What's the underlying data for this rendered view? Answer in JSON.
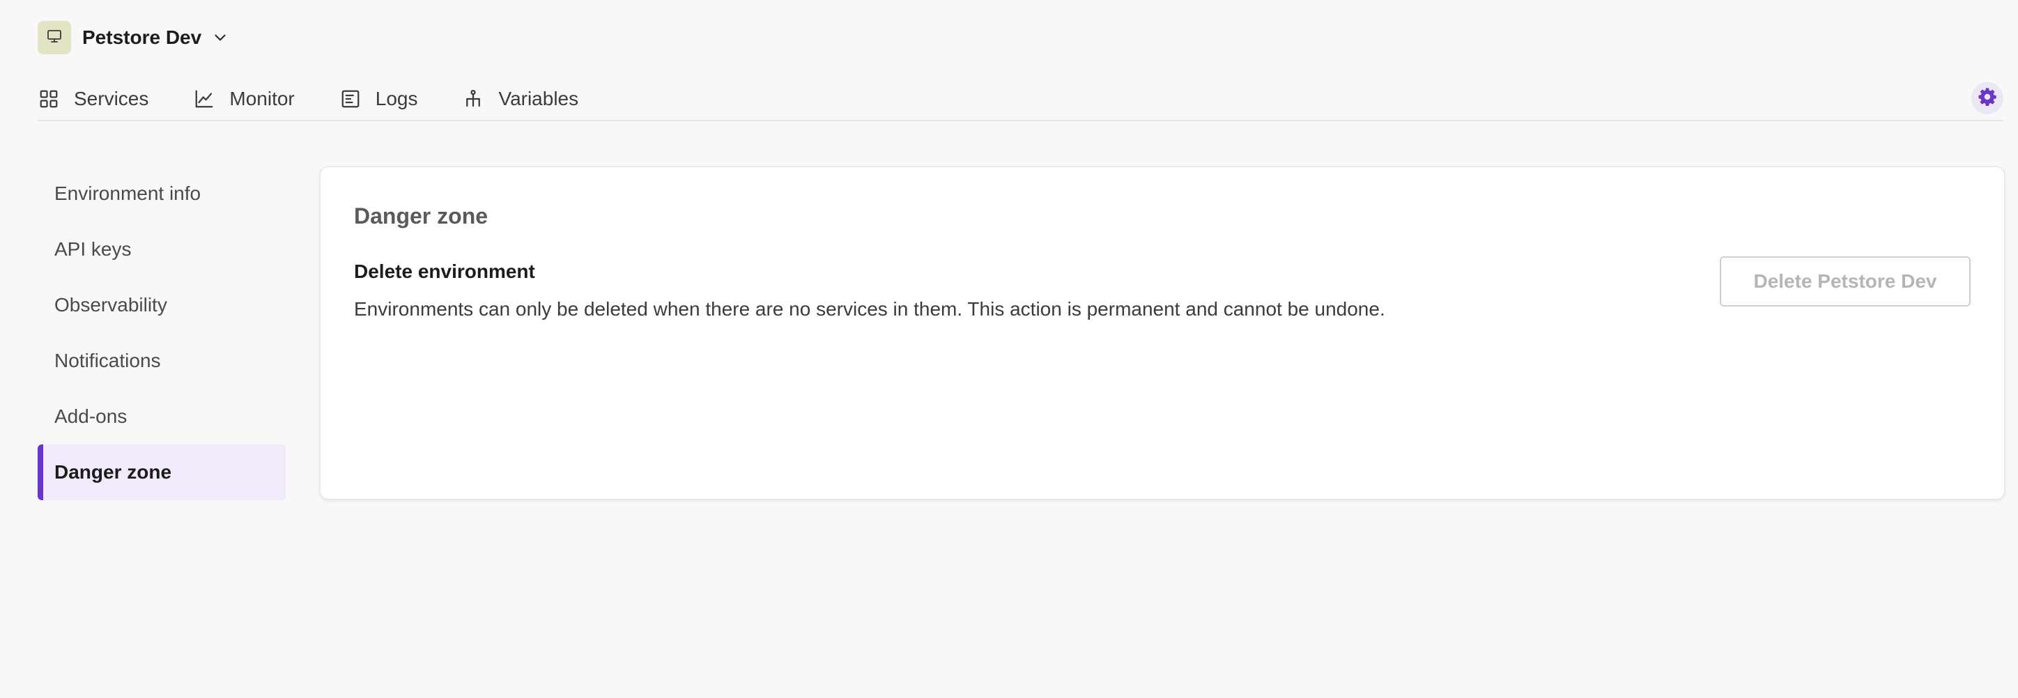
{
  "environment": {
    "name": "Petstore Dev",
    "icon": "monitor-icon",
    "dropdown_icon": "chevron-down-icon",
    "badge_color": "#e3e4c4"
  },
  "nav": {
    "tabs": [
      {
        "label": "Services",
        "icon": "grid-icon"
      },
      {
        "label": "Monitor",
        "icon": "line-chart-icon"
      },
      {
        "label": "Logs",
        "icon": "document-icon"
      },
      {
        "label": "Variables",
        "icon": "hierarchy-icon"
      }
    ],
    "settings_icon": "gear-icon"
  },
  "sidebar": {
    "items": [
      {
        "label": "Environment info",
        "active": false
      },
      {
        "label": "API keys",
        "active": false
      },
      {
        "label": "Observability",
        "active": false
      },
      {
        "label": "Notifications",
        "active": false
      },
      {
        "label": "Add-ons",
        "active": false
      },
      {
        "label": "Danger zone",
        "active": true
      }
    ]
  },
  "danger_zone": {
    "title": "Danger zone",
    "delete_section": {
      "title": "Delete environment",
      "description": "Environments can only be deleted when there are no services in them. This action is permanent and cannot be undone.",
      "button_label": "Delete Petstore Dev",
      "button_disabled": true
    }
  },
  "colors": {
    "accent": "#6c35c9",
    "active_bg": "#f0eafa",
    "page_bg": "#f8f8f8"
  }
}
